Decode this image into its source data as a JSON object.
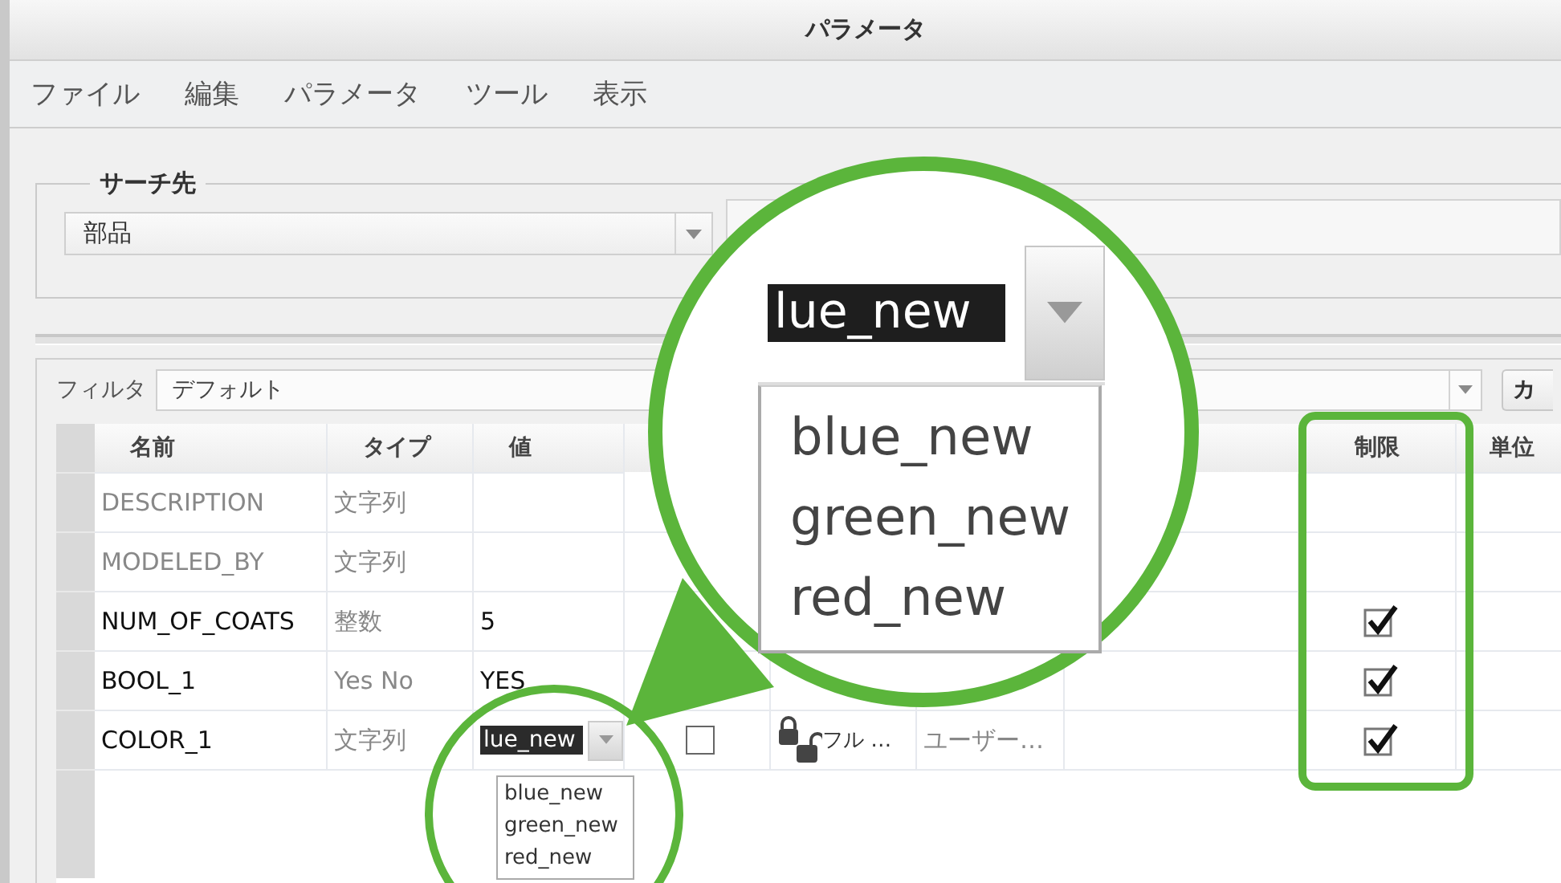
{
  "window": {
    "title": "パラメータ"
  },
  "menu": [
    {
      "label": "ファイル"
    },
    {
      "label": "編集"
    },
    {
      "label": "パラメータ"
    },
    {
      "label": "ツール"
    },
    {
      "label": "表示"
    }
  ],
  "search_scope": {
    "title": "サーチ先",
    "value": "部品"
  },
  "filter": {
    "label": "フィルタ",
    "value": "デフォルト",
    "button": "カ"
  },
  "table": {
    "columns": [
      {
        "label": "名前"
      },
      {
        "label": "タイプ"
      },
      {
        "label": "値"
      },
      {
        "label": "制限"
      },
      {
        "label": "単位"
      }
    ],
    "rows": [
      {
        "name": "DESCRIPTION",
        "disabled": true,
        "type": "文字列",
        "restricted": false
      },
      {
        "name": "MODELED_BY",
        "disabled": true,
        "type": "文字列",
        "restricted": false
      },
      {
        "name": "NUM_OF_COATS",
        "disabled": false,
        "type": "整数",
        "value": "5",
        "restricted": true
      },
      {
        "name": "BOOL_1",
        "disabled": false,
        "type": "Yes No",
        "value": "YES",
        "restricted": true
      },
      {
        "name": "COLOR_1",
        "disabled": false,
        "type": "文字列",
        "value": "lue_new",
        "options": [
          "blue_new",
          "green_new",
          "red_new"
        ],
        "checkbox": {
          "checked": false
        },
        "access": "フル …",
        "owner": "ユーザー…",
        "restricted": true
      }
    ]
  },
  "magnifier": {
    "value": "lue_new",
    "options": [
      "blue_new",
      "green_new",
      "red_new"
    ]
  }
}
